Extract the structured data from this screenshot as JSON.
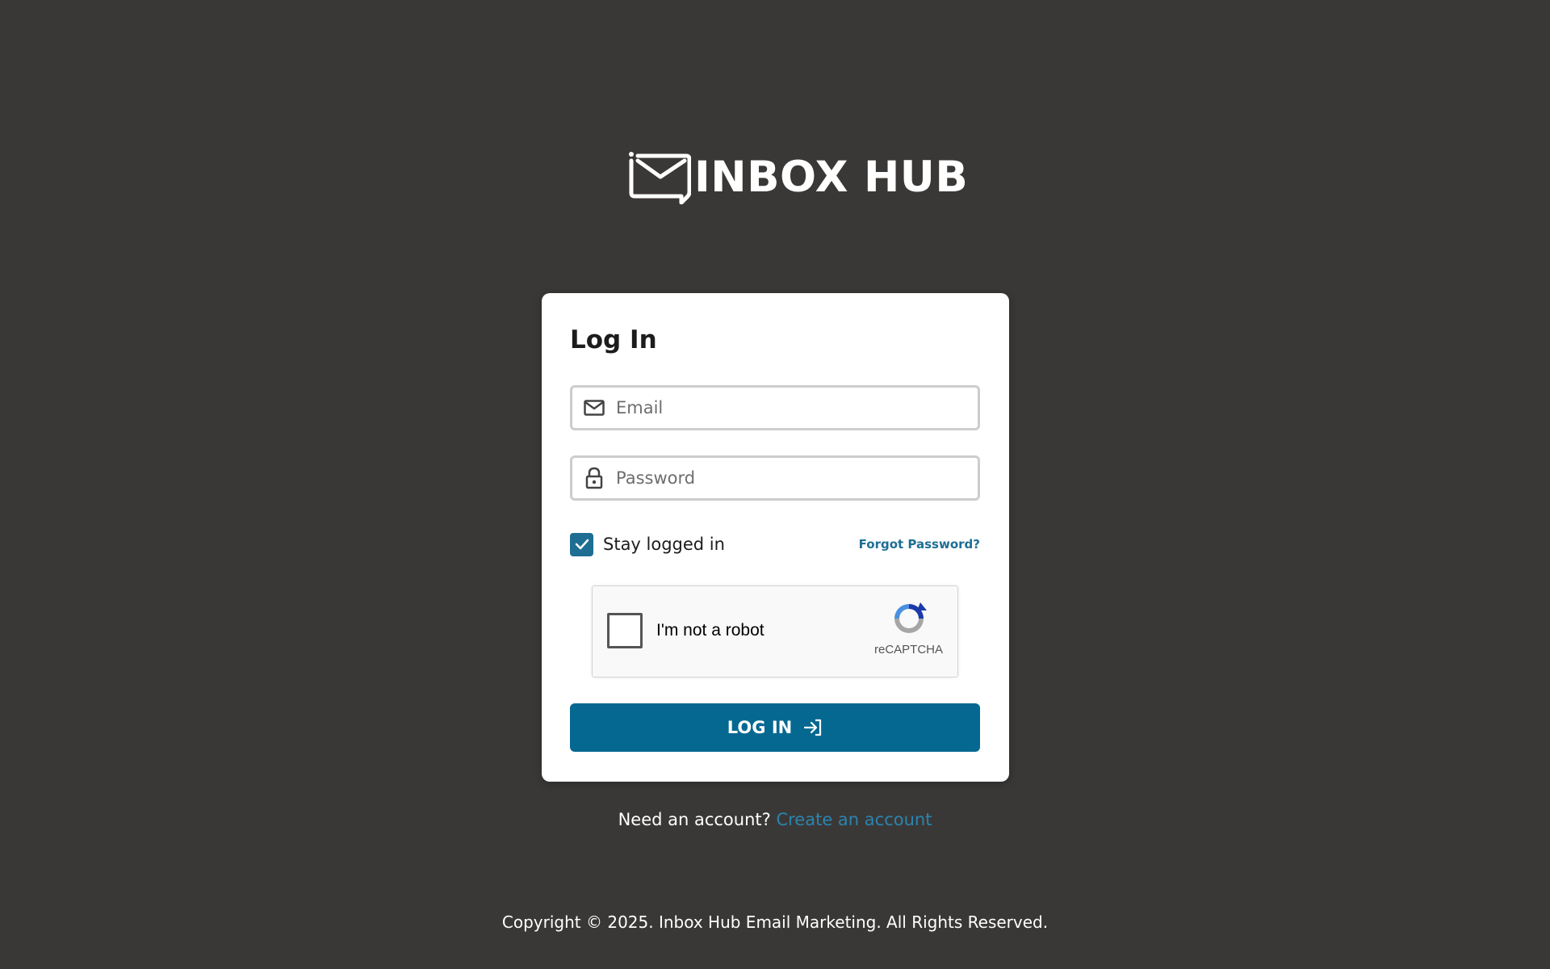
{
  "brand": {
    "name": "INBOX HUB",
    "logo_icon": "envelope-chat-icon"
  },
  "login": {
    "title": "Log In",
    "email_placeholder": "Email",
    "password_placeholder": "Password",
    "stay_logged_in_label": "Stay logged in",
    "stay_logged_in_checked": true,
    "forgot_password": "Forgot Password?",
    "submit_label": "LOG IN"
  },
  "recaptcha": {
    "label": "I'm not a robot",
    "brand": "reCAPTCHA"
  },
  "signup": {
    "prompt": "Need an account?",
    "link": "Create an account"
  },
  "footer": {
    "copyright": "Copyright © 2025. Inbox Hub Email Marketing. All Rights Reserved."
  },
  "colors": {
    "background": "#3a3836",
    "accent": "#056891",
    "link": "#2b84b0",
    "card": "#ffffff"
  }
}
